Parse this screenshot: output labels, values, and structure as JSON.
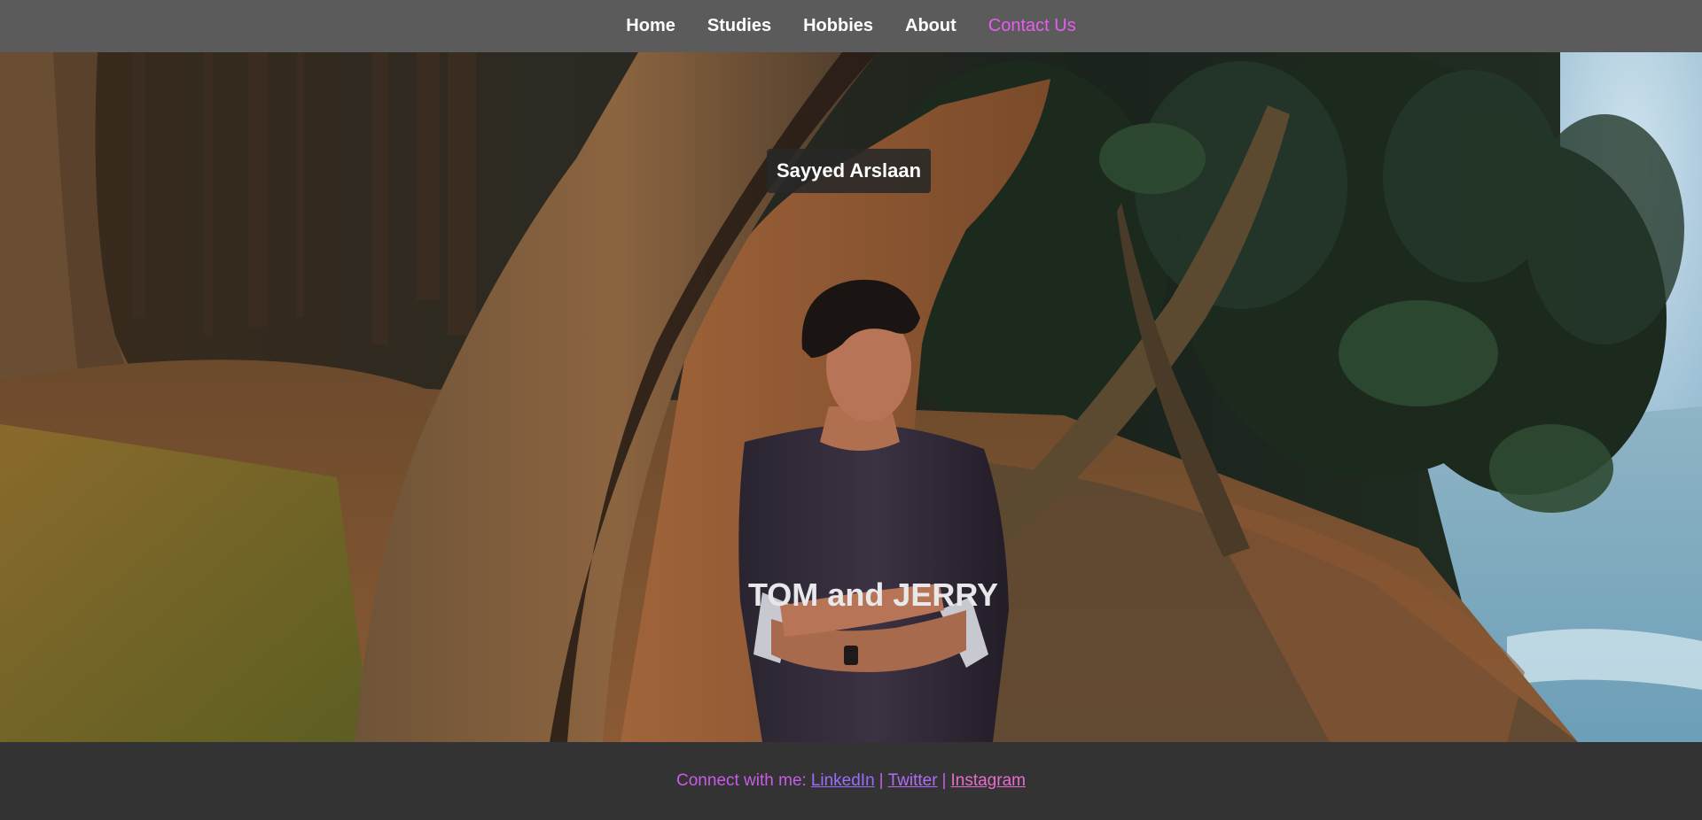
{
  "nav": {
    "items": [
      {
        "label": "Home",
        "active": false
      },
      {
        "label": "Studies",
        "active": false
      },
      {
        "label": "Hobbies",
        "active": false
      },
      {
        "label": "About",
        "active": false
      },
      {
        "label": "Contact Us",
        "active": true
      }
    ]
  },
  "hero": {
    "name": "Sayyed Arslaan",
    "shirt_text": "TOM and JERRY"
  },
  "footer": {
    "prefix": "Connect with me:",
    "separator": "|",
    "links": [
      "LinkedIn",
      "Twitter",
      "Instagram"
    ]
  },
  "colors": {
    "nav_bg": "#5b5b5b",
    "active_link": "#e85cf0",
    "footer_bg": "#333333",
    "footer_text": "#c85ce8"
  }
}
